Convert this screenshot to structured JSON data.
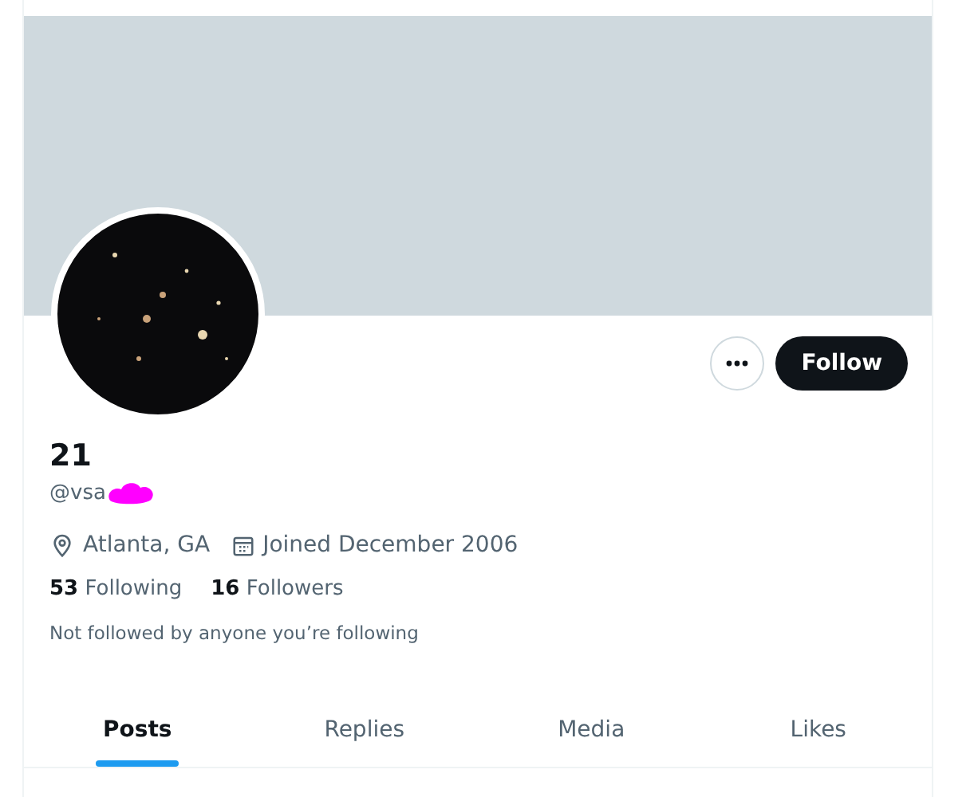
{
  "profile": {
    "name": "21",
    "handle": "@vsa",
    "location": "Atlanta, GA",
    "joined": "Joined December 2006",
    "following_count": "53",
    "following_label": "Following",
    "followers_count": "16",
    "followers_label": "Followers",
    "followed_by_note": "Not followed by anyone you’re following"
  },
  "actions": {
    "follow_label": "Follow"
  },
  "tabs": [
    {
      "label": "Posts",
      "selected": true
    },
    {
      "label": "Replies",
      "selected": false
    },
    {
      "label": "Media",
      "selected": false
    },
    {
      "label": "Likes",
      "selected": false
    }
  ]
}
